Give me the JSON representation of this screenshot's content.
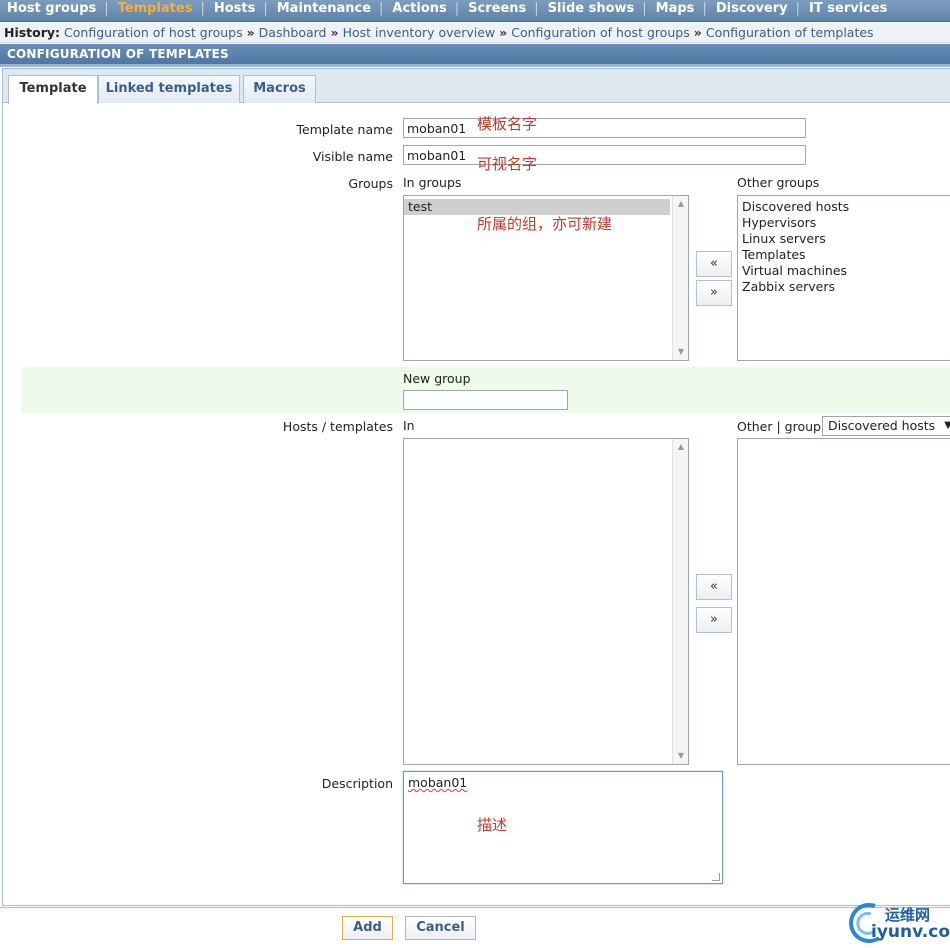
{
  "topmenu": {
    "items": [
      {
        "label": "Host groups",
        "active": false
      },
      {
        "label": "Templates",
        "active": true
      },
      {
        "label": "Hosts",
        "active": false
      },
      {
        "label": "Maintenance",
        "active": false
      },
      {
        "label": "Actions",
        "active": false
      },
      {
        "label": "Screens",
        "active": false
      },
      {
        "label": "Slide shows",
        "active": false
      },
      {
        "label": "Maps",
        "active": false
      },
      {
        "label": "Discovery",
        "active": false
      },
      {
        "label": "IT services",
        "active": false
      }
    ],
    "separator": "|"
  },
  "history": {
    "label": "History:",
    "items": [
      "Configuration of host groups",
      "Dashboard",
      "Host inventory overview",
      "Configuration of host groups",
      "Configuration of templates"
    ],
    "arrow": "»"
  },
  "section_title": "CONFIGURATION OF TEMPLATES",
  "tabs": [
    {
      "label": "Template",
      "active": true
    },
    {
      "label": "Linked templates",
      "active": false
    },
    {
      "label": "Macros",
      "active": false
    }
  ],
  "form": {
    "template_name_label": "Template name",
    "template_name_value": "moban01",
    "visible_name_label": "Visible name",
    "visible_name_value": "moban01",
    "groups_label": "Groups",
    "in_groups_label": "In groups",
    "in_groups": [
      "test"
    ],
    "other_groups_label": "Other groups",
    "other_groups": [
      "Discovered hosts",
      "Hypervisors",
      "Linux servers",
      "Templates",
      "Virtual machines",
      "Zabbix servers"
    ],
    "move_left": "«",
    "move_right": "»",
    "new_group_label": "New group",
    "new_group_value": "",
    "hosts_templates_label": "Hosts / templates",
    "in_label": "In",
    "other_group_label": "Other | group",
    "group_select_value": "Discovered hosts",
    "description_label": "Description",
    "description_value": "moban01"
  },
  "annotations": {
    "template_name": "模板名字",
    "visible_name": "可视名字",
    "groups": "所属的组，亦可新建",
    "description": "描述"
  },
  "buttons": {
    "add": "Add",
    "cancel": "Cancel"
  },
  "watermark": {
    "line1": "运维网",
    "line2": "iyunv.com"
  },
  "colors": {
    "menu_bg": "#5f83a9",
    "menu_active": "#f2b23a",
    "link": "#3a5f8c",
    "annotation": "#c0392b",
    "new_group_bg": "#eefbea"
  }
}
